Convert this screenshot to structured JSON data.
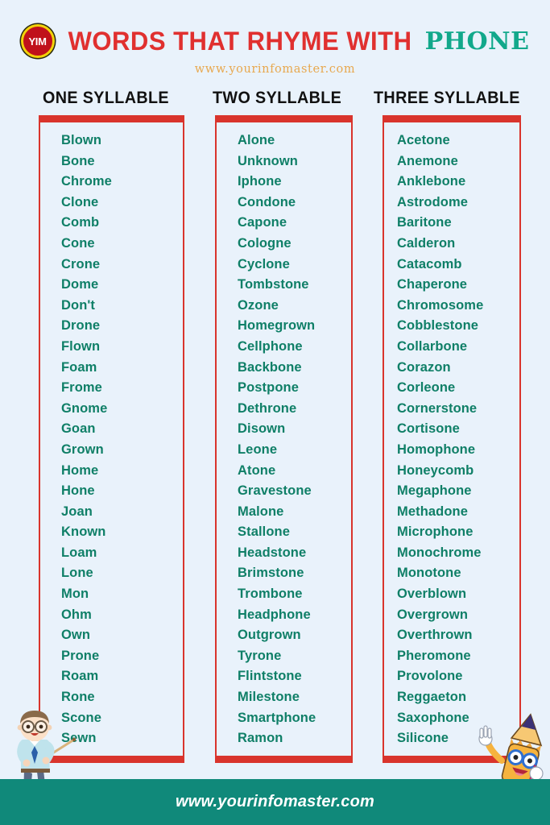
{
  "header": {
    "logo_text": "YIM",
    "title_main": "WORDS THAT RHYME WITH",
    "title_accent": "PHONE",
    "subtitle": "www.yourinfomaster.com"
  },
  "footer": {
    "url": "www.yourinfomaster.com"
  },
  "colors": {
    "background": "#e9f2fb",
    "title_red": "#e0302f",
    "accent_teal": "#12a88b",
    "word_green": "#0f7f67",
    "box_border_red": "#d9342c",
    "footer_teal": "#10897a",
    "subtitle_orange": "#e8a84e",
    "logo_red": "#c0111b",
    "logo_yellow": "#f2d20a"
  },
  "columns": [
    {
      "heading": "ONE SYLLABLE",
      "words": [
        "Blown",
        "Bone",
        "Chrome",
        "Clone",
        "Comb",
        "Cone",
        "Crone",
        "Dome",
        "Don't",
        "Drone",
        "Flown",
        "Foam",
        "Frome",
        "Gnome",
        "Goan",
        "Grown",
        "Home",
        "Hone",
        "Joan",
        "Known",
        "Loam",
        "Lone",
        "Mon",
        "Ohm",
        "Own",
        "Prone",
        "Roam",
        "Rone",
        "Scone",
        "Sewn"
      ]
    },
    {
      "heading": "TWO SYLLABLE",
      "words": [
        "Alone",
        "Unknown",
        "Iphone",
        "Condone",
        "Capone",
        "Cologne",
        "Cyclone",
        "Tombstone",
        "Ozone",
        "Homegrown",
        "Cellphone",
        "Backbone",
        "Postpone",
        "Dethrone",
        "Disown",
        "Leone",
        "Atone",
        "Gravestone",
        "Malone",
        "Stallone",
        "Headstone",
        "Brimstone",
        "Trombone",
        "Headphone",
        "Outgrown",
        "Tyrone",
        "Flintstone",
        "Milestone",
        "Smartphone",
        "Ramon"
      ]
    },
    {
      "heading": "THREE SYLLABLE",
      "words": [
        "Acetone",
        "Anemone",
        "Anklebone",
        "Astrodome",
        "Baritone",
        "Calderon",
        "Catacomb",
        "Chaperone",
        "Chromosome",
        "Cobblestone",
        "Collarbone",
        "Corazon",
        "Corleone",
        "Cornerstone",
        "Cortisone",
        "Homophone",
        "Honeycomb",
        "Megaphone",
        "Methadone",
        "Microphone",
        "Monochrome",
        "Monotone",
        "Overblown",
        "Overgrown",
        "Overthrown",
        "Pheromone",
        "Provolone",
        "Reggaeton",
        "Saxophone",
        "Silicone"
      ]
    }
  ],
  "mascots": {
    "teacher": "teacher-with-pointer",
    "pencil": "pencil-character-waving"
  }
}
